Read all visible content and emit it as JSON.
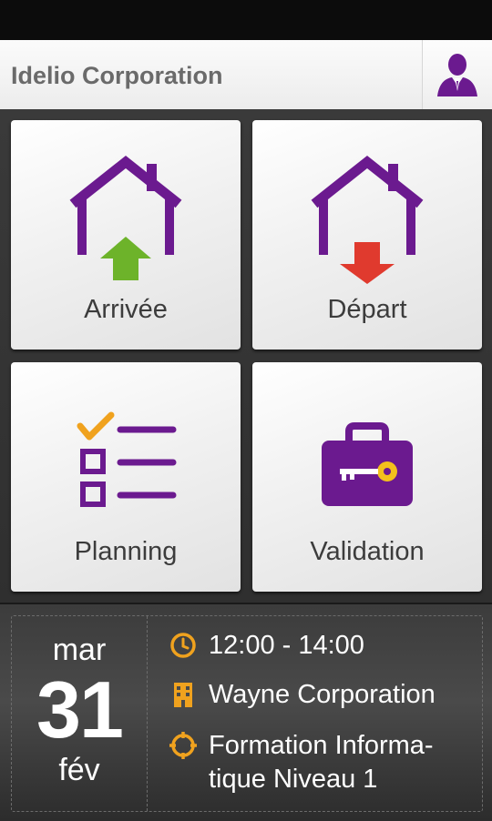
{
  "header": {
    "title": "Idelio Corporation"
  },
  "tiles": [
    {
      "label": "Arrivée"
    },
    {
      "label": "Départ"
    },
    {
      "label": "Planning"
    },
    {
      "label": "Validation"
    }
  ],
  "date": {
    "day_name": "mar",
    "day_number": "31",
    "month": "fév"
  },
  "info": {
    "time": "12:00 - 14:00",
    "company": "Wayne Corporation",
    "training": "Formation Informa-tique Niveau 1"
  },
  "icons": {
    "profile": "user-icon",
    "arrivee": "house-arrow-up-icon",
    "depart": "house-arrow-down-icon",
    "planning": "checklist-icon",
    "validation": "briefcase-key-icon",
    "time": "clock-icon",
    "company": "building-icon",
    "training": "target-icon"
  },
  "colors": {
    "purple": "#6b1a8f",
    "green": "#6db32a",
    "red": "#e03a2e",
    "orange": "#f0a21e"
  }
}
